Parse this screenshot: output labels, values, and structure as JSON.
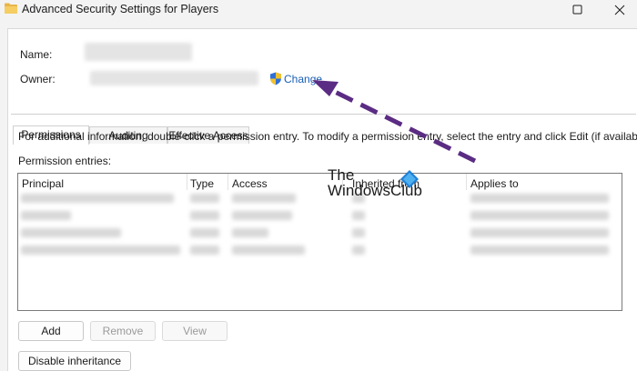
{
  "window": {
    "title": "Advanced Security Settings for Players"
  },
  "fields": {
    "name_label": "Name:",
    "owner_label": "Owner:",
    "change_link": "Change"
  },
  "tabs": [
    {
      "label": "Permissions",
      "active": true
    },
    {
      "label": "Auditing",
      "active": false
    },
    {
      "label": "Effective Access",
      "active": false
    }
  ],
  "info_text": "For additional information, double-click a permission entry. To modify a permission entry, select the entry and click Edit (if available).",
  "permission_entries_label": "Permission entries:",
  "table": {
    "headers": [
      "Principal",
      "Type",
      "Access",
      "Inherited from",
      "Applies to"
    ]
  },
  "buttons": {
    "add": "Add",
    "remove": "Remove",
    "view": "View",
    "disable_inheritance": "Disable inheritance"
  },
  "watermark": {
    "line1": "The",
    "line2": "WindowsClub"
  },
  "colors": {
    "link": "#1a5fb4",
    "arrow": "#5b2c83"
  }
}
